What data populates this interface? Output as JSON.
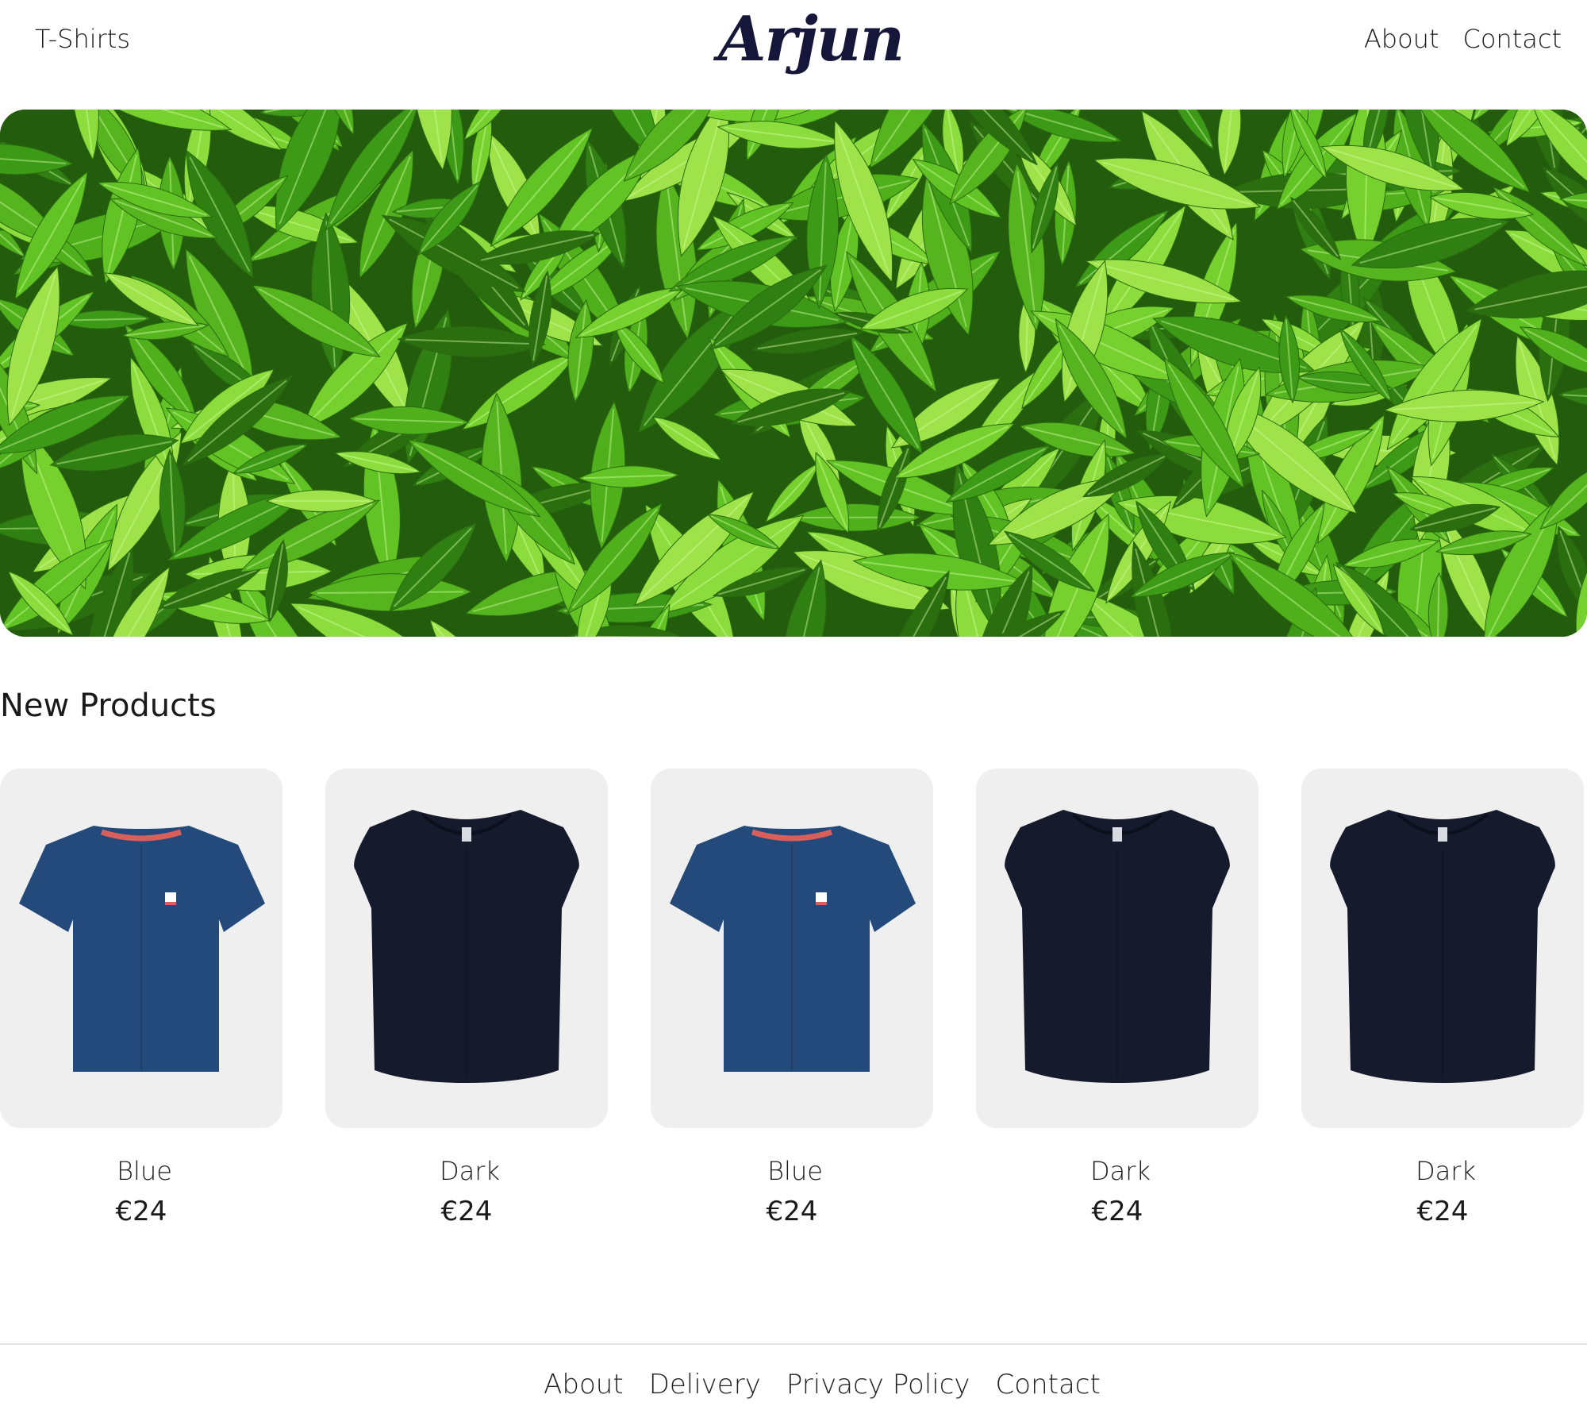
{
  "header": {
    "left_link": "T-Shirts",
    "brand": "Arjun",
    "right_links": [
      "About",
      "Contact"
    ]
  },
  "hero": {
    "image": "green-leaves"
  },
  "section": {
    "title": "New Products"
  },
  "products": [
    {
      "name": "Blue",
      "price": "€24",
      "shirt": "blue-tshirt",
      "color": "#234a7a"
    },
    {
      "name": "Dark",
      "price": "€24",
      "shirt": "dark-tshirt",
      "color": "#151a2c"
    },
    {
      "name": "Blue",
      "price": "€24",
      "shirt": "blue-tshirt",
      "color": "#234a7a"
    },
    {
      "name": "Dark",
      "price": "€24",
      "shirt": "dark-tshirt",
      "color": "#151a2c"
    },
    {
      "name": "Dark",
      "price": "€24",
      "shirt": "dark-tshirt",
      "color": "#151a2c"
    }
  ],
  "footer": {
    "links": [
      "About",
      "Delivery",
      "Privacy Policy",
      "Contact"
    ]
  },
  "colors": {
    "brand": "#16163a",
    "card_background": "#efefef",
    "blue_shirt": "#234a7a",
    "dark_shirt": "#151a2c",
    "collar_accent": "#d9605a"
  }
}
